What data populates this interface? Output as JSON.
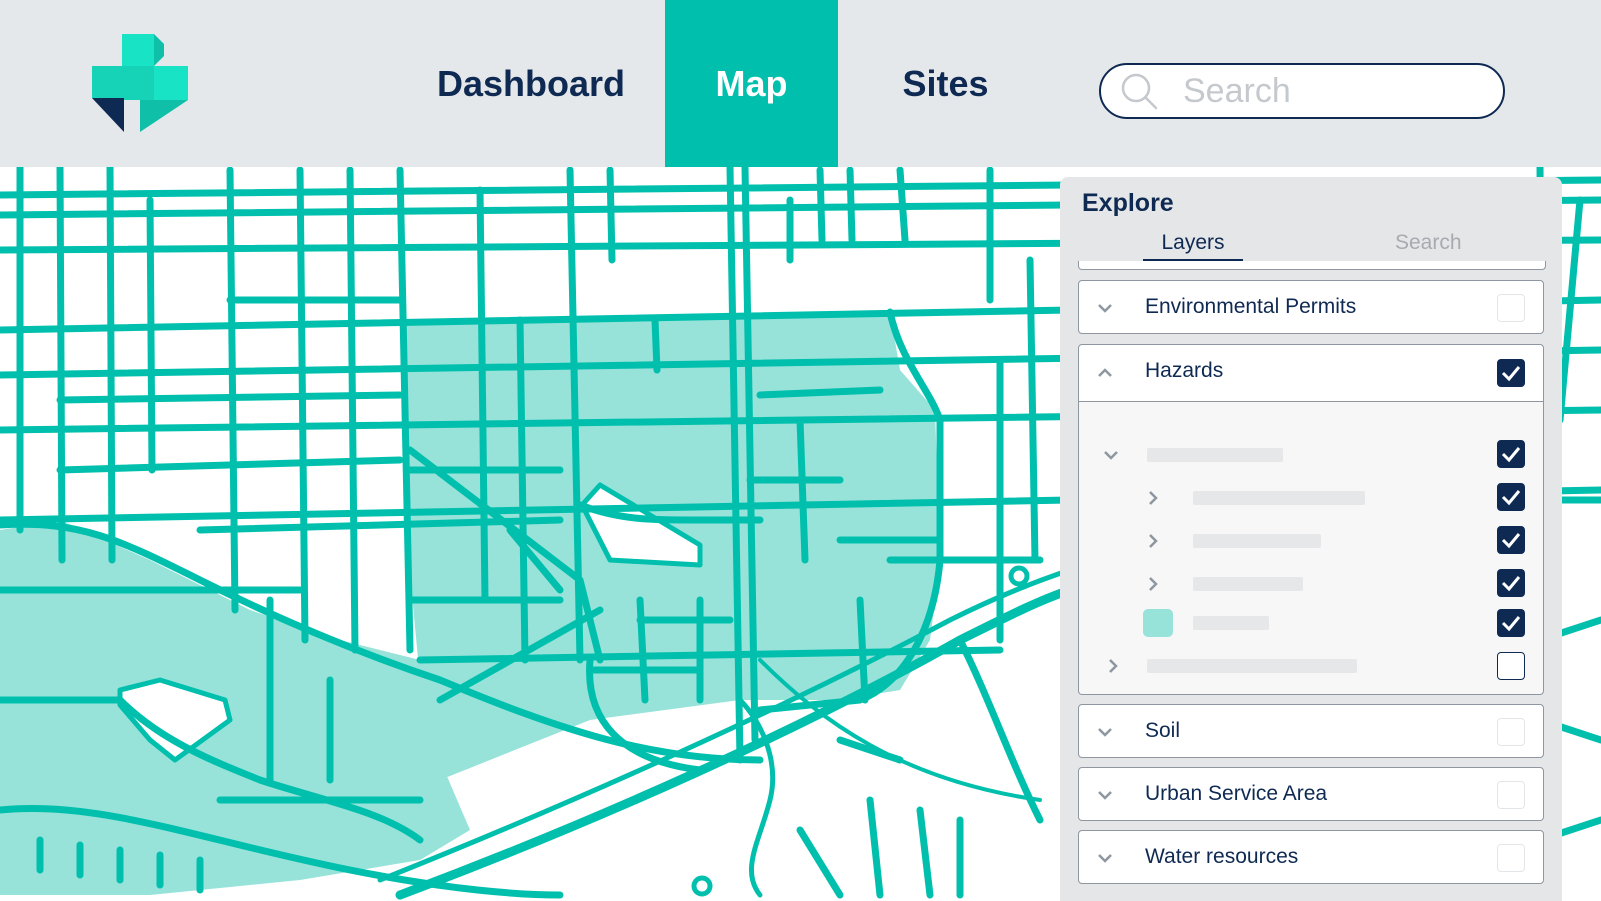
{
  "nav": {
    "items": [
      {
        "label": "Dashboard",
        "active": false
      },
      {
        "label": "Map",
        "active": true
      },
      {
        "label": "Sites",
        "active": false
      }
    ],
    "search_placeholder": "Search",
    "search_value": ""
  },
  "panel": {
    "title": "Explore",
    "tabs": [
      {
        "label": "Layers",
        "active": true
      },
      {
        "label": "Search",
        "active": false
      }
    ],
    "layers": [
      {
        "label": "Environmental Permits",
        "expanded": false,
        "checked": false
      },
      {
        "label": "Hazards",
        "expanded": true,
        "checked": true,
        "children": [
          {
            "expanded": true,
            "checked": true
          },
          {
            "expanded": false,
            "checked": true
          },
          {
            "expanded": false,
            "checked": true
          },
          {
            "expanded": false,
            "checked": true
          },
          {
            "swatch": true,
            "checked": true
          },
          {
            "expanded": false,
            "checked": false
          }
        ]
      },
      {
        "label": "Soil",
        "expanded": false,
        "checked": false
      },
      {
        "label": "Urban Service Area",
        "expanded": false,
        "checked": false
      },
      {
        "label": "Water resources",
        "expanded": false,
        "checked": false
      }
    ]
  },
  "colors": {
    "brand_teal": "#00c0ad",
    "navy": "#0f2a52",
    "zone_fill": "#97e3da",
    "header_bg": "#e5e8eb"
  },
  "icons": [
    "logo-mark",
    "search-icon",
    "chevron-down-icon",
    "chevron-up-icon",
    "chevron-right-icon",
    "checkmark-icon",
    "map-pin-icon"
  ]
}
